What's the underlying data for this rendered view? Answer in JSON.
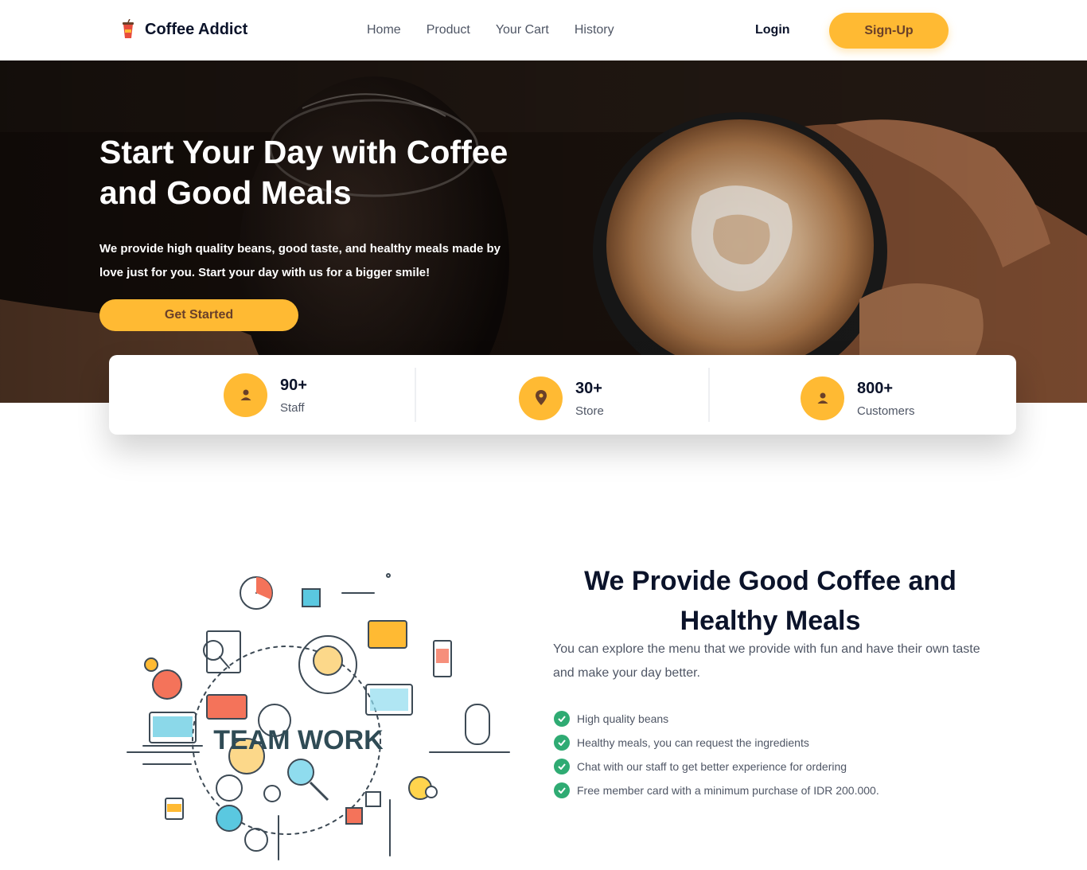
{
  "nav": {
    "brand": "Coffee Addict",
    "links": [
      "Home",
      "Product",
      "Your Cart",
      "History"
    ],
    "login": "Login",
    "signup": "Sign-Up"
  },
  "hero": {
    "title": "Start Your Day with Coffee and Good Meals",
    "subtitle": "We provide high quality beans, good taste, and healthy meals made by love just for you. Start your day with us for a bigger smile!",
    "cta": "Get Started"
  },
  "stats": [
    {
      "value": "90+",
      "label": "Staff",
      "icon": "user-icon"
    },
    {
      "value": "30+",
      "label": "Store",
      "icon": "location-pin-icon"
    },
    {
      "value": "800+",
      "label": "Customers",
      "icon": "user-icon"
    }
  ],
  "feature": {
    "illustration_text": "TEAM WORK",
    "title": "We Provide Good Coffee and Healthy Meals",
    "description": "You can explore the menu that we provide with fun and have their own taste and make your day better.",
    "items": [
      "High quality beans",
      "Healthy meals, you can request the ingredients",
      "Chat with our staff to get better experience for ordering",
      "Free member card with a minimum purchase of IDR 200.000."
    ]
  },
  "colors": {
    "accent": "#ffba33",
    "accent_text": "#6a4029",
    "dark_text": "#0b132a",
    "body_text": "#4f5665",
    "check_green": "#2fab73"
  }
}
